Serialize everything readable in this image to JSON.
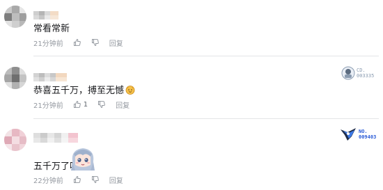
{
  "comments": [
    {
      "content": "常看常新",
      "time": "21分钟前",
      "like_count": "",
      "reply_label": "回复"
    },
    {
      "content": "恭喜五千万，搏至无憾",
      "time": "21分钟前",
      "like_count": "1",
      "reply_label": "回复",
      "badge": {
        "line1": "CD.",
        "line2": "003335"
      }
    },
    {
      "content": "五千万了呀",
      "time": "22分钟前",
      "like_count": "",
      "reply_label": "回复",
      "badge": {
        "line1": "NO.",
        "line2": "009403"
      }
    }
  ],
  "colors": {
    "text": "#18191c",
    "meta": "#9499a0",
    "divider": "#e3e5e7",
    "badge1": "#8a9bb0",
    "badge2": "#2a5bd7"
  }
}
